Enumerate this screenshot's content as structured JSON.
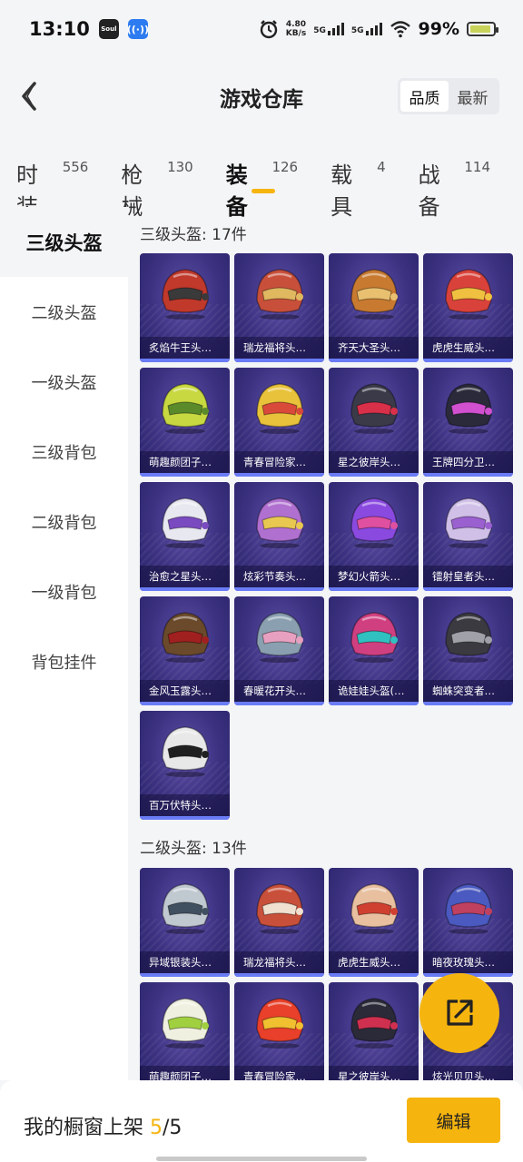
{
  "status_bar": {
    "time": "13:10",
    "app_icons": [
      "Soul",
      "((·))"
    ],
    "net_speed_value": "4.80",
    "net_speed_unit": "KB/s",
    "signal1": "5G",
    "signal2": "5G",
    "battery_percent": "99%"
  },
  "header": {
    "title": "游戏仓库",
    "sort_options": [
      "品质",
      "最新"
    ],
    "active_sort": "品质"
  },
  "tabs": [
    {
      "label": "时装",
      "count": "556"
    },
    {
      "label": "枪械",
      "count": "130"
    },
    {
      "label": "装备",
      "count": "126",
      "active": true
    },
    {
      "label": "载具",
      "count": "4"
    },
    {
      "label": "战备",
      "count": "114"
    }
  ],
  "sidebar": {
    "items": [
      "三级头盔",
      "二级头盔",
      "一级头盔",
      "三级背包",
      "二级背包",
      "一级背包",
      "背包挂件"
    ],
    "active_index": 0
  },
  "sections": [
    {
      "title": "三级头盔: 17件",
      "items": [
        {
          "name": "炙焰牛王头…",
          "color": "#c0392b",
          "accent": "#3a3a3a"
        },
        {
          "name": "瑞龙福将头…",
          "color": "#c8503a",
          "accent": "#e0b860"
        },
        {
          "name": "齐天大圣头…",
          "color": "#c87a30",
          "accent": "#e8c070"
        },
        {
          "name": "虎虎生威头…",
          "color": "#d9423a",
          "accent": "#f0c040"
        },
        {
          "name": "萌趣颜团子…",
          "color": "#c8d840",
          "accent": "#5a8a2a"
        },
        {
          "name": "青春冒险家…",
          "color": "#e8c23a",
          "accent": "#d94a3a"
        },
        {
          "name": "星之彼岸头…",
          "color": "#3a3a48",
          "accent": "#d9304a"
        },
        {
          "name": "王牌四分卫…",
          "color": "#2a2a3a",
          "accent": "#d050d0"
        },
        {
          "name": "治愈之星头…",
          "color": "#e8e8f0",
          "accent": "#7a4ac0"
        },
        {
          "name": "炫彩节奏头…",
          "color": "#b070d0",
          "accent": "#e8c850"
        },
        {
          "name": "梦幻火箭头…",
          "color": "#8a4ae0",
          "accent": "#e050a0"
        },
        {
          "name": "镭射皇者头…",
          "color": "#d0c0e8",
          "accent": "#9a60d0"
        },
        {
          "name": "金风玉露头…",
          "color": "#6a4a2a",
          "accent": "#a02020"
        },
        {
          "name": "春暖花开头…",
          "color": "#8aa0b0",
          "accent": "#e8a0c0"
        },
        {
          "name": "诡娃娃头盔(…",
          "color": "#d04080",
          "accent": "#30c0c0"
        },
        {
          "name": "蜘蛛突变者…",
          "color": "#3a3a40",
          "accent": "#a0a0a8"
        },
        {
          "name": "百万伏特头…",
          "color": "#e8e8e8",
          "accent": "#202020"
        }
      ]
    },
    {
      "title": "二级头盔: 13件",
      "items": [
        {
          "name": "异域银装头…",
          "color": "#c0c8d0",
          "accent": "#405060"
        },
        {
          "name": "瑞龙福将头…",
          "color": "#c8503a",
          "accent": "#f0e0d0"
        },
        {
          "name": "虎虎生威头…",
          "color": "#e8c0a0",
          "accent": "#d04030"
        },
        {
          "name": "暗夜玫瑰头…",
          "color": "#4a5ac0",
          "accent": "#c04060"
        },
        {
          "name": "萌趣颜团子…",
          "color": "#f0f0e0",
          "accent": "#a0d040"
        },
        {
          "name": "青春冒险家…",
          "color": "#e8402a",
          "accent": "#f0c030"
        },
        {
          "name": "星之彼岸头…",
          "color": "#2a2a38",
          "accent": "#d03050"
        },
        {
          "name": "炫光贝贝头…",
          "color": "#8060c0",
          "accent": "#e0a040"
        }
      ]
    }
  ],
  "bottom_bar": {
    "label_prefix": "我的橱窗上架 ",
    "count_current": "5",
    "count_sep_total": "/5",
    "edit_label": "编辑"
  }
}
